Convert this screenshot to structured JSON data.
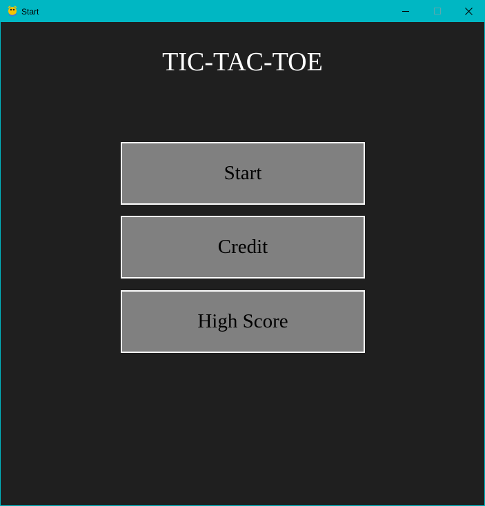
{
  "window": {
    "title": "Start",
    "app_icon": "pygame-snake-icon",
    "controls": {
      "minimize": "minimize-icon",
      "maximize": "maximize-icon",
      "close": "close-icon"
    },
    "colors": {
      "titlebar": "#00b7c3",
      "background": "#1f1f1f"
    }
  },
  "game": {
    "title": "TIC-TAC-TOE",
    "buttons": {
      "start": "Start",
      "credit": "Credit",
      "high_score": "High Score"
    },
    "colors": {
      "button_fill": "#808080",
      "button_border": "#ffffff",
      "title_text": "#ffffff",
      "button_text": "#000000"
    }
  }
}
